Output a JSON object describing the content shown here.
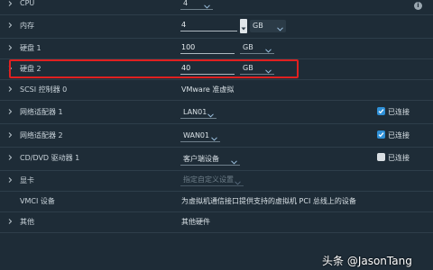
{
  "colors": {
    "background": "#1e2c37",
    "highlight_border": "#e02020",
    "checkbox_checked": "#2e8fd6"
  },
  "rows": {
    "cpu": {
      "label": "CPU",
      "value": "4"
    },
    "memory": {
      "label": "内存",
      "value": "4",
      "unit": "GB"
    },
    "disk1": {
      "label": "硬盘 1",
      "value": "100",
      "unit": "GB"
    },
    "disk2": {
      "label": "硬盘 2",
      "value": "40",
      "unit": "GB"
    },
    "scsi": {
      "label": "SCSI 控制器 0",
      "value": "VMware 准虚拟"
    },
    "nic1": {
      "label": "网络适配器 1",
      "value": "LAN01",
      "connect_label": "已连接",
      "connected": true
    },
    "nic2": {
      "label": "网络适配器 2",
      "value": "WAN01",
      "connect_label": "已连接",
      "connected": true
    },
    "cdrom": {
      "label": "CD/DVD 驱动器 1",
      "value": "客户端设备",
      "connect_label": "已连接",
      "connected": false
    },
    "video": {
      "label": "显卡",
      "value": "指定自定义设置"
    },
    "vmci": {
      "label": "VMCI 设备",
      "value": "为虚拟机通信接口提供支持的虚拟机 PCI 总线上的设备"
    },
    "other": {
      "label": "其他",
      "value": "其他硬件"
    }
  },
  "icons": {
    "info": "info-icon",
    "expand": "chevron-right-icon",
    "dropdown": "chevron-down-icon"
  },
  "watermark": "头条 @JasonTang"
}
